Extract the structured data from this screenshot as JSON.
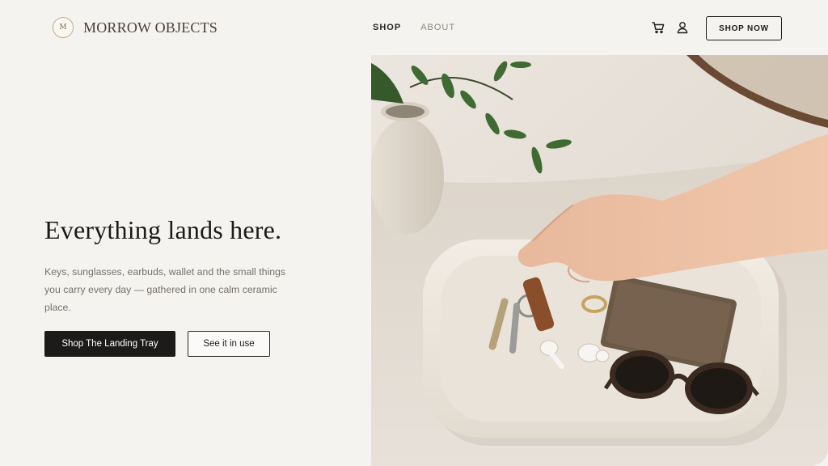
{
  "brand": {
    "name": "MORROW OBJECTS",
    "monogram": "M"
  },
  "nav": {
    "items": [
      {
        "label": "SHOP",
        "active": true
      },
      {
        "label": "ABOUT",
        "active": false
      }
    ]
  },
  "header_actions": {
    "cart_icon": "cart-icon",
    "account_icon": "user-icon",
    "shop_now_label": "SHOP NOW"
  },
  "hero": {
    "title": "Everything lands here.",
    "body": "Keys, sunglasses, earbuds, wallet and the small things you carry every day — gathered in one calm ceramic place.",
    "primary_cta": "Shop The Landing Tray",
    "secondary_cta": "See it in use"
  },
  "colors": {
    "background": "#f5f3ef",
    "primary_button": "#1d1b1a",
    "text_muted": "#76716b",
    "accent_logo": "#c9a98a"
  }
}
